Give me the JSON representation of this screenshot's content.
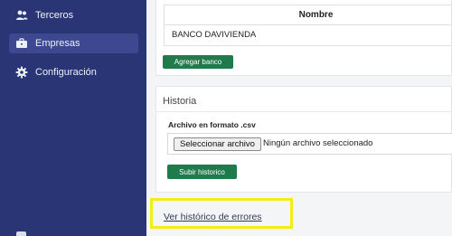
{
  "sidebar": {
    "items": [
      {
        "label": "Terceros",
        "icon": "users-icon"
      },
      {
        "label": "Empresas",
        "icon": "briefcase-icon",
        "active": true
      },
      {
        "label": "Configuración",
        "icon": "gear-icon"
      }
    ]
  },
  "banks": {
    "header": "Nombre",
    "rows": [
      "BANCO DAVIVIENDA"
    ],
    "add_button": "Agregar banco"
  },
  "history": {
    "title": "Historia",
    "file_label": "Archivo en formato .csv",
    "file_button": "Seleccionar archivo",
    "file_status": "Ningún archivo seleccionado",
    "upload_button": "Subir historico",
    "errors_link": "Ver histórico de errores"
  },
  "colors": {
    "sidebar_bg": "#2a3576",
    "sidebar_active": "#3c4890",
    "button_green": "#1f7a4c",
    "highlight_yellow": "#f2ee14"
  }
}
